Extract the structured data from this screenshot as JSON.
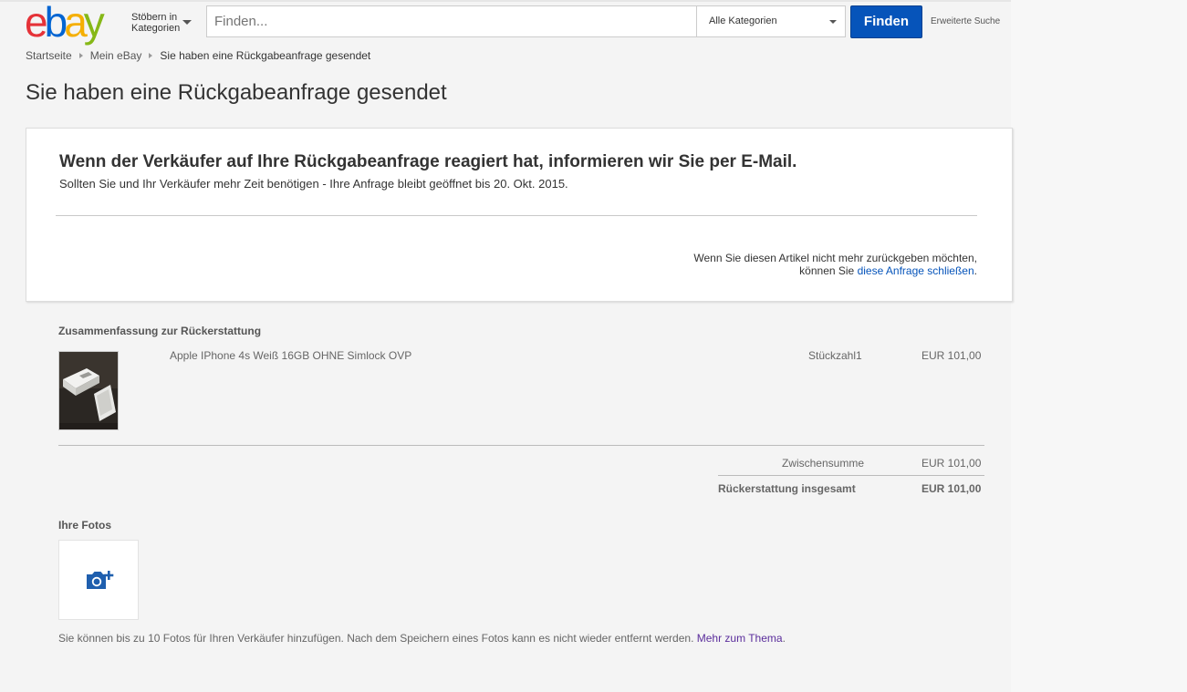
{
  "header": {
    "logo_letters": [
      "e",
      "b",
      "a",
      "y"
    ],
    "logo_colors": [
      "#e53238",
      "#0064d2",
      "#f5af02",
      "#86b817"
    ],
    "browse_line1": "Stöbern in",
    "browse_line2": "Kategorien",
    "search_placeholder": "Finden...",
    "category_selected": "Alle Kategorien",
    "find_button": "Finden",
    "advanced_search": "Erweiterte Suche",
    "accent": "#0654ba"
  },
  "breadcrumb": {
    "items": [
      "Startseite",
      "Mein eBay"
    ],
    "current": "Sie haben eine Rückgabeanfrage gesendet"
  },
  "page_title": "Sie haben eine Rückgabeanfrage gesendet",
  "notice": {
    "headline": "Wenn der Verkäufer auf Ihre Rückgabeanfrage reagiert hat, informieren wir Sie per E-Mail.",
    "subtext": "Sollten Sie und Ihr Verkäufer mehr Zeit benötigen - Ihre Anfrage bleibt geöffnet bis 20. Okt. 2015.",
    "close_line1": "Wenn Sie diesen Artikel nicht mehr zurückgeben möchten,",
    "close_line2_prefix": "können Sie ",
    "close_link": "diese Anfrage schließen",
    "close_suffix": "."
  },
  "summary": {
    "title": "Zusammenfassung zur Rückerstattung",
    "item": {
      "name": "Apple IPhone 4s Weiß 16GB OHNE Simlock OVP",
      "quantity_label": "Stückzahl",
      "quantity": "1",
      "price": "EUR 101,00"
    },
    "subtotal_label": "Zwischensumme",
    "subtotal_value": "EUR 101,00",
    "total_label": "Rückerstattung insgesamt",
    "total_value": "EUR 101,00"
  },
  "photos": {
    "title": "Ihre Fotos",
    "add_icon": "camera-plus-icon",
    "note": "Sie können bis zu 10 Fotos für Ihren Verkäufer hinzufügen. Nach dem Speichern eines Fotos kann es nicht wieder entfernt werden. ",
    "more_link": "Mehr zum Thema",
    "more_suffix": "."
  }
}
